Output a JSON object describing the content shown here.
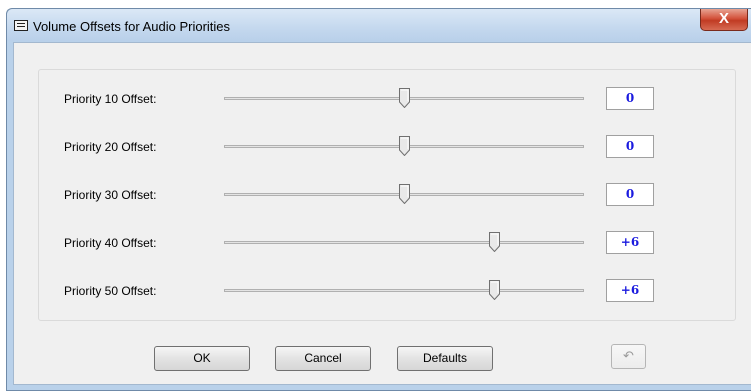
{
  "window": {
    "title": "Volume Offsets for Audio Priorities",
    "close_glyph": "X"
  },
  "sliders": [
    {
      "label": "Priority 10 Offset:",
      "value_text": "0",
      "level": 0.5
    },
    {
      "label": "Priority 20 Offset:",
      "value_text": "0",
      "level": 0.5
    },
    {
      "label": "Priority 30 Offset:",
      "value_text": "0",
      "level": 0.5
    },
    {
      "label": "Priority 40 Offset:",
      "value_text": "+6",
      "level": 0.75
    },
    {
      "label": "Priority 50 Offset:",
      "value_text": "+6",
      "level": 0.75
    }
  ],
  "buttons": {
    "ok": "OK",
    "cancel": "Cancel",
    "defaults": "Defaults",
    "undo_glyph": "↶"
  },
  "colors": {
    "value_text": "#1a1adf",
    "title_bar": "#c4d8ee",
    "close_button": "#c13b23"
  }
}
